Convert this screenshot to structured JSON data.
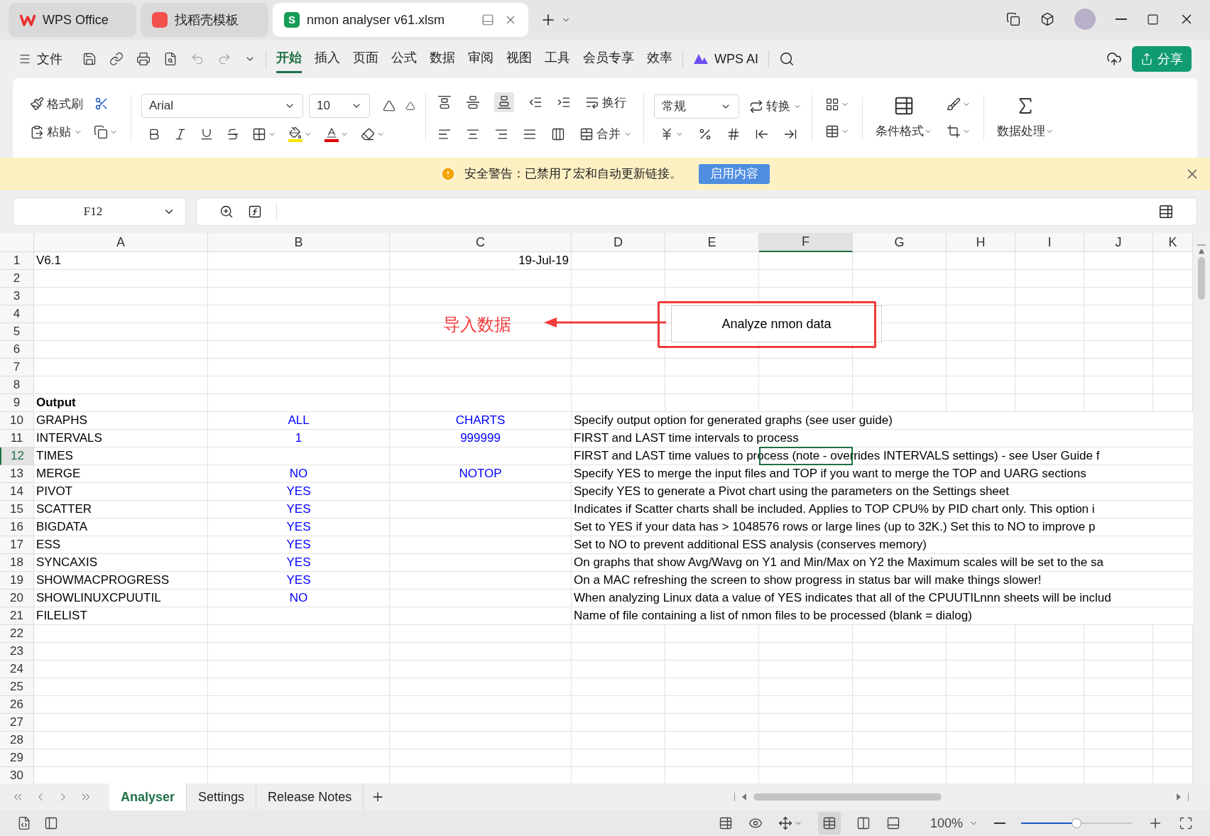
{
  "app_tabs": [
    {
      "label": "WPS Office",
      "kind": "home",
      "selected": false
    },
    {
      "label": "找稻壳模板",
      "kind": "template",
      "selected": false
    },
    {
      "label": "nmon analyser v61.xlsm",
      "kind": "sheet",
      "icon_letter": "S",
      "selected": true
    }
  ],
  "menu": {
    "file": "文件",
    "tabs": [
      {
        "label": "开始",
        "selected": true
      },
      {
        "label": "插入",
        "selected": false
      },
      {
        "label": "页面",
        "selected": false
      },
      {
        "label": "公式",
        "selected": false
      },
      {
        "label": "数据",
        "selected": false
      },
      {
        "label": "审阅",
        "selected": false
      },
      {
        "label": "视图",
        "selected": false
      },
      {
        "label": "工具",
        "selected": false
      },
      {
        "label": "会员专享",
        "selected": false
      },
      {
        "label": "效率",
        "selected": false
      }
    ],
    "ai": "WPS AI",
    "share": "分享"
  },
  "ribbon": {
    "format_painter": "格式刷",
    "paste": "粘贴",
    "font": "Arial",
    "size": "10",
    "wrap": "换行",
    "merge": "合并",
    "number_format": "常规",
    "convert": "转换",
    "conditional": "条件格式",
    "data_processing": "数据处理"
  },
  "warning": {
    "text": "安全警告：已禁用了宏和自动更新链接。",
    "button": "启用内容"
  },
  "name_box": "F12",
  "columns": [
    {
      "label": "A",
      "selected": false
    },
    {
      "label": "B",
      "selected": false
    },
    {
      "label": "C",
      "selected": false
    },
    {
      "label": "D",
      "selected": false
    },
    {
      "label": "E",
      "selected": false
    },
    {
      "label": "F",
      "selected": true
    },
    {
      "label": "G",
      "selected": false
    },
    {
      "label": "H",
      "selected": false
    },
    {
      "label": "I",
      "selected": false
    },
    {
      "label": "J",
      "selected": false
    },
    {
      "label": "K",
      "selected": false
    }
  ],
  "rows": [
    {
      "number": "1",
      "selected": false,
      "a": "V6.1",
      "date": "19-Jul-19"
    },
    {
      "number": "2",
      "selected": false
    },
    {
      "number": "3",
      "selected": false
    },
    {
      "number": "4",
      "selected": false
    },
    {
      "number": "5",
      "selected": false
    },
    {
      "number": "6",
      "selected": false
    },
    {
      "number": "7",
      "selected": false
    },
    {
      "number": "8",
      "selected": false
    },
    {
      "number": "9",
      "selected": false,
      "heading": "Output"
    },
    {
      "number": "10",
      "selected": false,
      "a": "GRAPHS",
      "b": "ALL",
      "c": "CHARTS",
      "d": "Specify output option for generated graphs (see user guide)"
    },
    {
      "number": "11",
      "selected": false,
      "a": "INTERVALS",
      "b": "1",
      "c": "999999",
      "d": "FIRST and LAST time intervals to process"
    },
    {
      "number": "12",
      "selected": true,
      "a": "TIMES",
      "d": "FIRST and LAST time values to process (note - overrides INTERVALS settings) - see User Guide f"
    },
    {
      "number": "13",
      "selected": false,
      "a": "MERGE",
      "b": "NO",
      "c": "NOTOP",
      "d": "Specify YES to merge the input files and TOP if you want to merge the TOP and UARG sections"
    },
    {
      "number": "14",
      "selected": false,
      "a": "PIVOT",
      "b": "YES",
      "d": "Specify YES to generate a Pivot chart using the parameters on the Settings sheet"
    },
    {
      "number": "15",
      "selected": false,
      "a": "SCATTER",
      "b": "YES",
      "d": "Indicates if Scatter charts shall be included.  Applies to TOP CPU% by PID chart only.  This option i"
    },
    {
      "number": "16",
      "selected": false,
      "a": "BIGDATA",
      "b": "YES",
      "d": "Set to YES if your data has > 1048576 rows or large lines (up to 32K.)  Set this to NO to improve p"
    },
    {
      "number": "17",
      "selected": false,
      "a": "ESS",
      "b": "YES",
      "d": "Set to NO to prevent additional ESS analysis (conserves memory)"
    },
    {
      "number": "18",
      "selected": false,
      "a": "SYNCAXIS",
      "b": "YES",
      "d": "On graphs that show Avg/Wavg on Y1 and Min/Max on Y2 the Maximum scales will be set to the sa"
    },
    {
      "number": "19",
      "selected": false,
      "a": "SHOWMACPROGRESS",
      "b": "YES",
      "d": "On a MAC refreshing the screen to show progress in status bar will make things slower!"
    },
    {
      "number": "20",
      "selected": false,
      "a": "SHOWLINUXCPUUTIL",
      "b": "NO",
      "d": "When analyzing Linux data a value of YES indicates that all of the CPUUTILnnn sheets will be includ"
    },
    {
      "number": "21",
      "selected": false,
      "a": "FILELIST",
      "d": "Name of file containing a list of nmon files to be processed (blank = dialog)"
    },
    {
      "number": "22",
      "selected": false
    },
    {
      "number": "23",
      "selected": false
    },
    {
      "number": "24",
      "selected": false
    },
    {
      "number": "25",
      "selected": false
    },
    {
      "number": "26",
      "selected": false
    },
    {
      "number": "27",
      "selected": false
    },
    {
      "number": "28",
      "selected": false
    },
    {
      "number": "29",
      "selected": false
    },
    {
      "number": "30",
      "selected": false
    }
  ],
  "sheet_button": "Analyze nmon data",
  "annotation": "导入数据",
  "sheet_tabs": [
    {
      "label": "Analyser",
      "selected": true
    },
    {
      "label": "Settings",
      "selected": false
    },
    {
      "label": "Release Notes",
      "selected": false
    }
  ],
  "zoom": {
    "reading": "100%",
    "level": 0.5
  }
}
